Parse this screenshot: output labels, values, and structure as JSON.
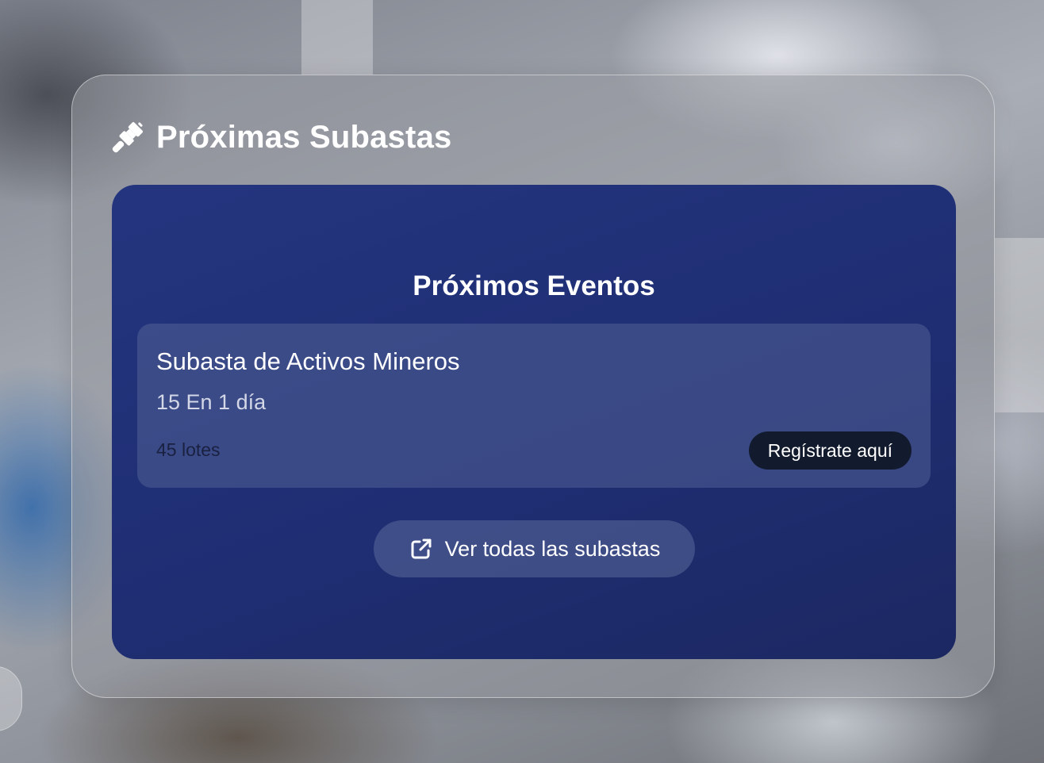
{
  "panel": {
    "title": "Próximas Subastas",
    "title_icon": "gavel-icon"
  },
  "events": {
    "heading": "Próximos Eventos",
    "items": [
      {
        "name": "Subasta de Activos Mineros",
        "date": "15 En 1 día",
        "lots": "45 lotes",
        "register_label": "Regístrate aquí"
      }
    ],
    "view_all_label": "Ver todas las subastas",
    "view_all_icon": "external-link-icon"
  },
  "colors": {
    "card_background": "#22337c",
    "register_button": "#121a2e",
    "text_primary": "#ffffff"
  }
}
